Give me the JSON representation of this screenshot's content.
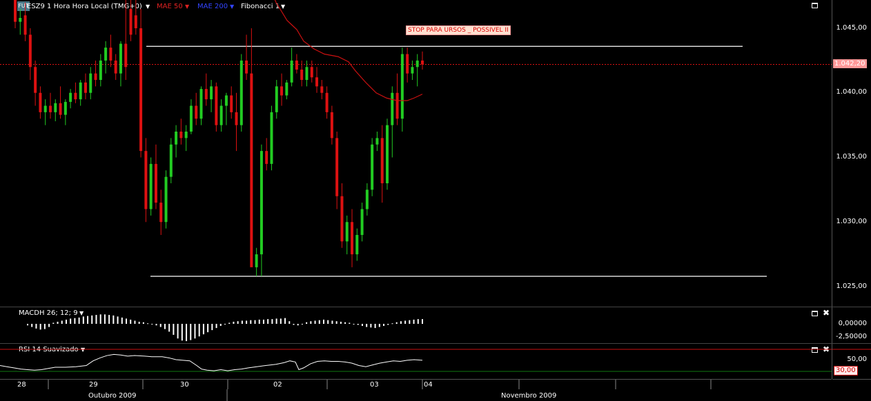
{
  "header": {
    "logo_text": "FUT",
    "symbol": "ESZ9 1 Hora Hora Local (TMG+0)",
    "ind1": "MAE 50",
    "ind2": "MAE 200",
    "ind3": "Fibonacci 1"
  },
  "price_axis": {
    "ticks": [
      "1.045,00",
      "1.040,00",
      "1.035,00",
      "1.030,00",
      "1.025,00"
    ],
    "current_price_label": "1.042,20"
  },
  "annotation": "STOP PARA URSOS _ POSSIVEL II",
  "macd": {
    "label": "MACDH 26; 12; 9",
    "ticks": [
      "0,00000",
      "-2,50000"
    ]
  },
  "rsi": {
    "label": "RSI 14 Suavizado",
    "ticks": [
      "50,00"
    ],
    "level_label": "30,00"
  },
  "time_axis": {
    "days": [
      "28",
      "29",
      "30",
      "02",
      "03",
      "04"
    ],
    "months": [
      "Outubro 2009",
      "Novembro 2009"
    ]
  },
  "colors": {
    "up": "#22cc22",
    "down": "#dd1111",
    "mae50": "#cc1111",
    "mae200": "#2222ff",
    "fib": "#ffffff",
    "price_line": "#dd1111",
    "annotation_bg": "#ffe0d0",
    "annotation_text": "#dd0000"
  },
  "chart_data": {
    "type": "candlestick",
    "ylim": [
      1024.2,
      1047.6
    ],
    "fib_levels": [
      1043.6,
      1025.8
    ],
    "current_price": 1042.2,
    "candles": [
      [
        1047.2,
        1047.5,
        1045.0,
        1045.5
      ],
      [
        1045.5,
        1046.5,
        1044.5,
        1045.8
      ],
      [
        1046.0,
        1047.0,
        1044.0,
        1044.5
      ],
      [
        1044.5,
        1045.0,
        1041.0,
        1042.0
      ],
      [
        1042.0,
        1042.5,
        1039.0,
        1040.0
      ],
      [
        1040.0,
        1040.5,
        1038.0,
        1038.5
      ],
      [
        1038.5,
        1039.5,
        1037.5,
        1039.0
      ],
      [
        1039.0,
        1040.0,
        1038.0,
        1038.5
      ],
      [
        1038.5,
        1039.5,
        1037.8,
        1039.2
      ],
      [
        1039.2,
        1040.5,
        1038.0,
        1038.3
      ],
      [
        1038.3,
        1039.5,
        1037.5,
        1039.3
      ],
      [
        1039.3,
        1040.3,
        1038.8,
        1040.0
      ],
      [
        1040.0,
        1040.8,
        1039.2,
        1039.5
      ],
      [
        1039.5,
        1041.0,
        1039.0,
        1040.8
      ],
      [
        1040.8,
        1041.5,
        1039.5,
        1040.0
      ],
      [
        1040.0,
        1042.0,
        1039.5,
        1041.5
      ],
      [
        1041.5,
        1042.5,
        1040.5,
        1041.0
      ],
      [
        1041.0,
        1043.0,
        1040.5,
        1042.5
      ],
      [
        1042.5,
        1044.0,
        1041.5,
        1043.5
      ],
      [
        1043.5,
        1044.5,
        1042.0,
        1042.5
      ],
      [
        1042.5,
        1043.0,
        1041.0,
        1041.5
      ],
      [
        1041.5,
        1044.0,
        1040.5,
        1043.8
      ],
      [
        1043.8,
        1047.5,
        1041.0,
        1042.0
      ],
      [
        1046.5,
        1047.6,
        1044.0,
        1044.5
      ],
      [
        1046.0,
        1047.5,
        1044.5,
        1045.0
      ],
      [
        1045.0,
        1046.5,
        1035.0,
        1035.5
      ],
      [
        1035.5,
        1036.5,
        1030.0,
        1031.0
      ],
      [
        1031.0,
        1035.0,
        1030.5,
        1034.5
      ],
      [
        1034.5,
        1036.0,
        1031.0,
        1031.5
      ],
      [
        1031.5,
        1032.5,
        1029.0,
        1030.0
      ],
      [
        1030.0,
        1034.0,
        1029.5,
        1033.5
      ],
      [
        1033.5,
        1036.5,
        1033.0,
        1036.0
      ],
      [
        1036.0,
        1037.5,
        1035.0,
        1037.0
      ],
      [
        1037.0,
        1038.0,
        1036.0,
        1036.5
      ],
      [
        1036.5,
        1037.5,
        1035.5,
        1037.0
      ],
      [
        1037.0,
        1039.5,
        1036.8,
        1039.0
      ],
      [
        1039.0,
        1040.0,
        1037.5,
        1038.0
      ],
      [
        1038.0,
        1040.5,
        1037.5,
        1040.3
      ],
      [
        1040.3,
        1041.5,
        1039.0,
        1039.5
      ],
      [
        1039.5,
        1041.0,
        1038.5,
        1040.5
      ],
      [
        1040.5,
        1040.8,
        1037.0,
        1037.5
      ],
      [
        1037.5,
        1039.5,
        1037.0,
        1039.0
      ],
      [
        1039.0,
        1040.0,
        1037.5,
        1039.8
      ],
      [
        1039.8,
        1040.5,
        1038.0,
        1038.5
      ],
      [
        1038.5,
        1040.0,
        1035.5,
        1037.5
      ],
      [
        1037.5,
        1043.0,
        1037.0,
        1042.5
      ],
      [
        1042.5,
        1044.5,
        1041.0,
        1041.5
      ],
      [
        1041.5,
        1045.0,
        1035.5,
        1026.5
      ],
      [
        1026.5,
        1028.0,
        1025.8,
        1027.5
      ],
      [
        1027.5,
        1036.0,
        1025.8,
        1035.5
      ],
      [
        1035.5,
        1036.5,
        1034.0,
        1034.5
      ],
      [
        1034.5,
        1039.0,
        1034.0,
        1038.5
      ],
      [
        1038.5,
        1041.0,
        1038.0,
        1040.5
      ],
      [
        1040.5,
        1041.5,
        1039.0,
        1039.8
      ],
      [
        1039.8,
        1041.0,
        1039.5,
        1040.8
      ],
      [
        1040.8,
        1043.5,
        1040.5,
        1042.5
      ],
      [
        1042.5,
        1043.0,
        1041.5,
        1041.8
      ],
      [
        1041.8,
        1042.5,
        1040.5,
        1041.0
      ],
      [
        1041.0,
        1042.5,
        1040.5,
        1042.0
      ],
      [
        1042.0,
        1042.5,
        1040.8,
        1041.2
      ],
      [
        1041.2,
        1042.0,
        1040.0,
        1040.5
      ],
      [
        1040.5,
        1041.0,
        1039.5,
        1040.0
      ],
      [
        1040.0,
        1040.5,
        1038.0,
        1038.5
      ],
      [
        1038.5,
        1039.0,
        1036.0,
        1036.5
      ],
      [
        1036.5,
        1037.0,
        1031.0,
        1032.0
      ],
      [
        1032.0,
        1033.0,
        1028.0,
        1028.5
      ],
      [
        1028.5,
        1030.5,
        1027.5,
        1030.0
      ],
      [
        1030.0,
        1031.0,
        1026.5,
        1027.5
      ],
      [
        1027.5,
        1029.5,
        1027.0,
        1029.0
      ],
      [
        1029.0,
        1031.5,
        1028.5,
        1031.0
      ],
      [
        1031.0,
        1033.0,
        1030.5,
        1032.5
      ],
      [
        1032.5,
        1036.5,
        1032.0,
        1036.0
      ],
      [
        1036.0,
        1037.0,
        1035.5,
        1036.5
      ],
      [
        1036.5,
        1037.5,
        1031.5,
        1033.0
      ],
      [
        1033.0,
        1038.0,
        1032.5,
        1037.5
      ],
      [
        1037.5,
        1040.5,
        1035.0,
        1040.0
      ],
      [
        1040.0,
        1041.5,
        1037.5,
        1038.0
      ],
      [
        1038.0,
        1043.5,
        1037.0,
        1043.0
      ],
      [
        1043.0,
        1043.5,
        1040.8,
        1041.5
      ],
      [
        1041.5,
        1042.5,
        1041.0,
        1042.0
      ],
      [
        1042.0,
        1043.0,
        1040.5,
        1042.5
      ],
      [
        1042.5,
        1043.2,
        1041.8,
        1042.2
      ]
    ],
    "mae50": [
      [
        395,
        1047.6
      ],
      [
        400,
        1047.0
      ],
      [
        408,
        1046.3
      ],
      [
        416,
        1045.6
      ],
      [
        424,
        1045.2
      ],
      [
        430,
        1044.9
      ],
      [
        440,
        1044.0
      ],
      [
        455,
        1043.4
      ],
      [
        470,
        1043.0
      ],
      [
        490,
        1042.8
      ],
      [
        505,
        1042.4
      ],
      [
        515,
        1041.7
      ],
      [
        530,
        1040.8
      ],
      [
        545,
        1040.0
      ],
      [
        560,
        1039.6
      ],
      [
        575,
        1039.4
      ],
      [
        590,
        1039.4
      ],
      [
        600,
        1039.6
      ],
      [
        612,
        1039.9
      ]
    ],
    "macd_hist": [
      -0.3,
      -0.6,
      -0.9,
      -1.1,
      -1.0,
      -0.6,
      0.2,
      0.4,
      0.6,
      0.8,
      1.0,
      1.1,
      1.2,
      1.4,
      1.5,
      1.6,
      1.7,
      1.8,
      1.8,
      1.7,
      1.6,
      1.4,
      1.2,
      1.0,
      0.8,
      0.6,
      0.4,
      0.3,
      0.1,
      -0.1,
      -0.3,
      -0.6,
      -1.0,
      -1.5,
      -2.1,
      -2.8,
      -3.2,
      -3.3,
      -3.1,
      -2.8,
      -2.4,
      -2.0,
      -1.6,
      -1.2,
      -0.8,
      -0.4,
      -0.1,
      0.2,
      0.4,
      0.5,
      0.6,
      0.6,
      0.7,
      0.7,
      0.8,
      0.8,
      0.9,
      0.9,
      1.0,
      1.0,
      1.1,
      0.5,
      -0.2,
      -0.3,
      -0.1,
      0.3,
      0.5,
      0.6,
      0.7,
      0.8,
      0.7,
      0.6,
      0.5,
      0.4,
      0.3,
      0.2,
      0.0,
      -0.2,
      -0.4,
      -0.6,
      -0.7,
      -0.8,
      -0.6,
      -0.4,
      -0.2,
      0.1,
      0.3,
      0.5,
      0.6,
      0.7,
      0.8,
      0.9,
      0.9
    ],
    "rsi": [
      [
        0,
        40
      ],
      [
        10,
        38
      ],
      [
        20,
        36
      ],
      [
        30,
        34
      ],
      [
        40,
        33
      ],
      [
        50,
        32
      ],
      [
        60,
        33
      ],
      [
        70,
        35
      ],
      [
        80,
        37
      ],
      [
        95,
        37
      ],
      [
        110,
        38
      ],
      [
        125,
        40
      ],
      [
        135,
        48
      ],
      [
        145,
        53
      ],
      [
        155,
        57
      ],
      [
        165,
        59
      ],
      [
        175,
        58
      ],
      [
        185,
        56
      ],
      [
        195,
        57
      ],
      [
        210,
        56
      ],
      [
        220,
        55
      ],
      [
        235,
        55
      ],
      [
        245,
        53
      ],
      [
        255,
        50
      ],
      [
        265,
        49
      ],
      [
        275,
        48
      ],
      [
        285,
        40
      ],
      [
        292,
        34
      ],
      [
        300,
        32
      ],
      [
        310,
        31
      ],
      [
        320,
        33
      ],
      [
        330,
        31
      ],
      [
        340,
        33
      ],
      [
        350,
        34
      ],
      [
        360,
        36
      ],
      [
        372,
        38
      ],
      [
        385,
        40
      ],
      [
        400,
        42
      ],
      [
        412,
        45
      ],
      [
        420,
        48
      ],
      [
        428,
        46
      ],
      [
        433,
        33
      ],
      [
        440,
        36
      ],
      [
        450,
        43
      ],
      [
        460,
        47
      ],
      [
        470,
        48
      ],
      [
        480,
        47
      ],
      [
        490,
        47
      ],
      [
        500,
        46
      ],
      [
        510,
        44
      ],
      [
        520,
        40
      ],
      [
        530,
        38
      ],
      [
        540,
        41
      ],
      [
        550,
        44
      ],
      [
        560,
        46
      ],
      [
        570,
        48
      ],
      [
        580,
        47
      ],
      [
        590,
        49
      ],
      [
        600,
        50
      ],
      [
        612,
        49
      ]
    ]
  }
}
